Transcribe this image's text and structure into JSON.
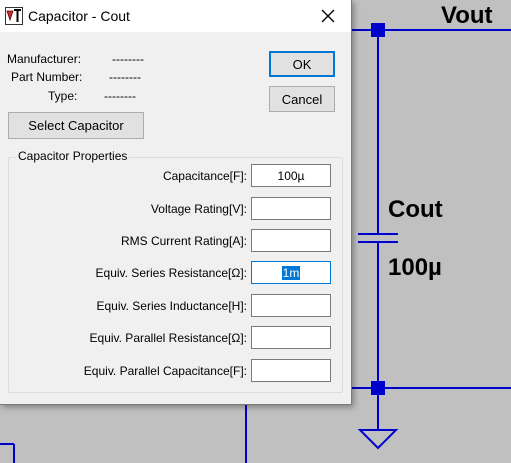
{
  "window": {
    "title": "Capacitor - Cout"
  },
  "info": {
    "manufacturer_label": "Manufacturer:",
    "manufacturer_value": "--------",
    "part_number_label": "Part Number:",
    "part_number_value": "--------",
    "type_label": "Type:",
    "type_value": "--------"
  },
  "buttons": {
    "ok": "OK",
    "cancel": "Cancel",
    "select_capacitor": "Select Capacitor"
  },
  "properties": {
    "group_title": "Capacitor Properties",
    "fields": [
      {
        "label": "Capacitance[F]:",
        "value": "100µ"
      },
      {
        "label": "Voltage Rating[V]:",
        "value": ""
      },
      {
        "label": "RMS Current Rating[A]:",
        "value": ""
      },
      {
        "label": "Equiv. Series Resistance[Ω]:",
        "value": "1m"
      },
      {
        "label": "Equiv. Series Inductance[H]:",
        "value": ""
      },
      {
        "label": "Equiv. Parallel Resistance[Ω]:",
        "value": ""
      },
      {
        "label": "Equiv. Parallel Capacitance[F]:",
        "value": ""
      }
    ]
  },
  "schematic": {
    "net_label": "Vout",
    "component_name": "Cout",
    "component_value": "100µ",
    "wire_color": "#0000cc"
  }
}
